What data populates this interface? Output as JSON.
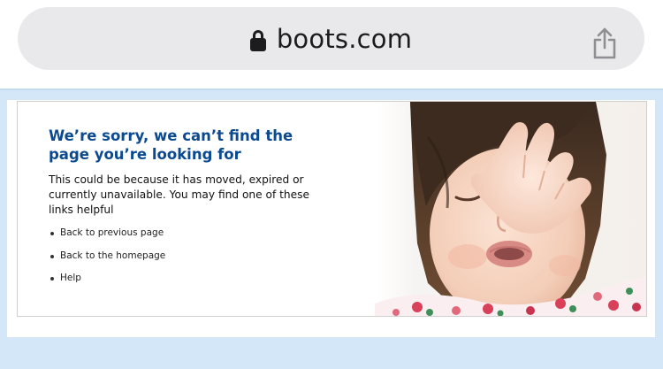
{
  "browser": {
    "url": "boots.com",
    "lock_icon": "lock-icon",
    "share_icon": "share-icon"
  },
  "error_page": {
    "heading": "We’re sorry, we can’t find the page you’re looking for",
    "intro": "This could be because it has moved, expired or currently unavailable. You may find one of these links helpful",
    "links": [
      {
        "label": "Back to previous page"
      },
      {
        "label": "Back to the homepage"
      },
      {
        "label": "Help"
      }
    ]
  },
  "colors": {
    "heading": "#0b4a8f",
    "page_background": "#d3e7f8",
    "url_bar": "#e9e9ec"
  }
}
